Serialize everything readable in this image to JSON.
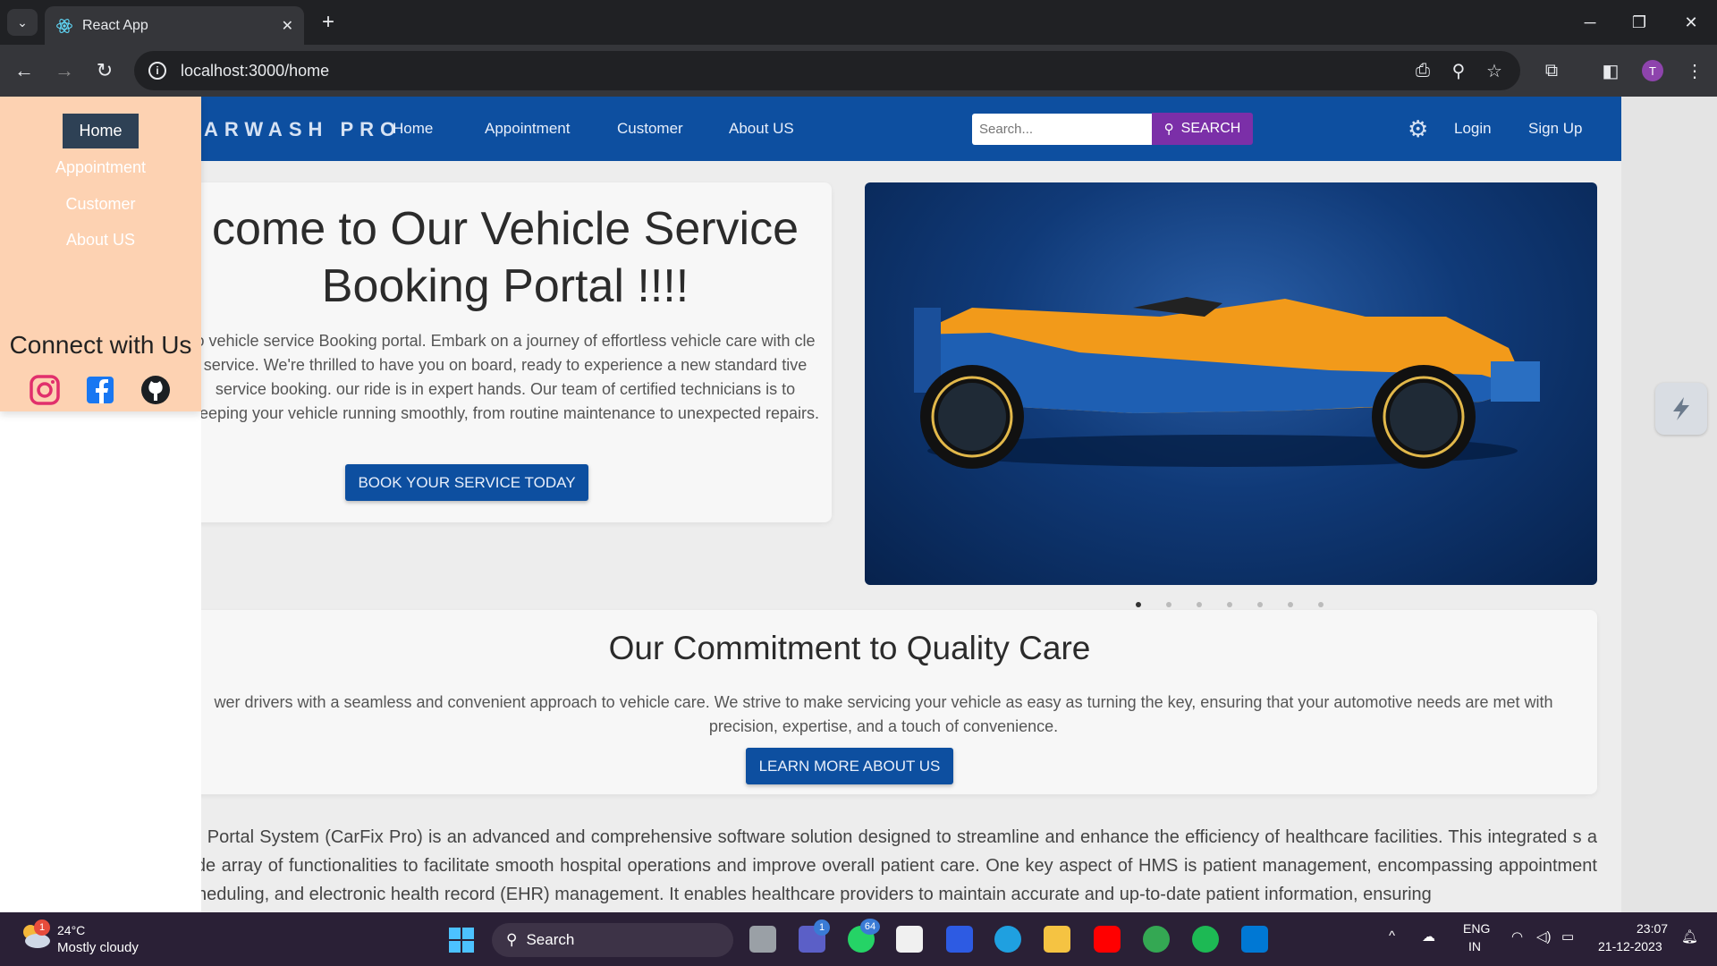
{
  "browser": {
    "tab_title": "React App",
    "url": "localhost:3000/home"
  },
  "navbar": {
    "brand": "ARWASH PRO",
    "links": [
      "Home",
      "Appointment",
      "Customer",
      "About US"
    ],
    "search_placeholder": "Search...",
    "search_button": "SEARCH",
    "login": "Login",
    "signup": "Sign Up"
  },
  "sidebar": {
    "items": [
      "Home",
      "Appointment",
      "Customer",
      "About US"
    ],
    "connect_title": "Connect with Us",
    "social_icons": [
      "instagram-icon",
      "facebook-icon",
      "github-icon"
    ]
  },
  "welcome": {
    "title_line1": "come to Our Vehicle Service",
    "title_line2": "Booking Portal !!!!",
    "paragraph": "o vehicle service Booking portal. Embark on a journey of effortless vehicle care with cle service. We're thrilled to have you on board, ready to experience a new standard tive service booking. our ride is in expert hands. Our team of certified technicians is to keeping your vehicle running smoothly, from routine maintenance to unexpected repairs.",
    "button": "BOOK YOUR SERVICE TODAY"
  },
  "carousel": {
    "slide_count": 7,
    "active_index": 0
  },
  "commitment": {
    "title": "Our Commitment to Quality Care",
    "paragraph": "wer drivers with a seamless and convenient approach to vehicle care. We strive to make servicing your vehicle as easy as turning the key, ensuring that your automotive needs are met with precision, expertise, and a touch of convenience.",
    "button": "LEARN MORE ABOUT US"
  },
  "about": {
    "paragraph": "ice Portal System (CarFix Pro) is an advanced and comprehensive software solution designed to streamline and enhance the efficiency of healthcare facilities. This integrated s a wide array of functionalities to facilitate smooth hospital operations and improve overall patient care. One key aspect of HMS is patient management, encompassing appointment scheduling, and electronic health record (EHR) management. It enables healthcare providers to maintain accurate and up-to-date patient information, ensuring"
  },
  "taskbar": {
    "weather_temp": "24°C",
    "weather_desc": "Mostly cloudy",
    "weather_badge": "1",
    "search_label": "Search",
    "teams_badge": "1",
    "whatsapp_badge": "64",
    "lang_line1": "ENG",
    "lang_line2": "IN",
    "time": "23:07",
    "date": "21-12-2023"
  },
  "colors": {
    "navbar": "#0d4fa0",
    "sidebar": "#fdd2b2",
    "search_button": "#7b2fa8"
  }
}
